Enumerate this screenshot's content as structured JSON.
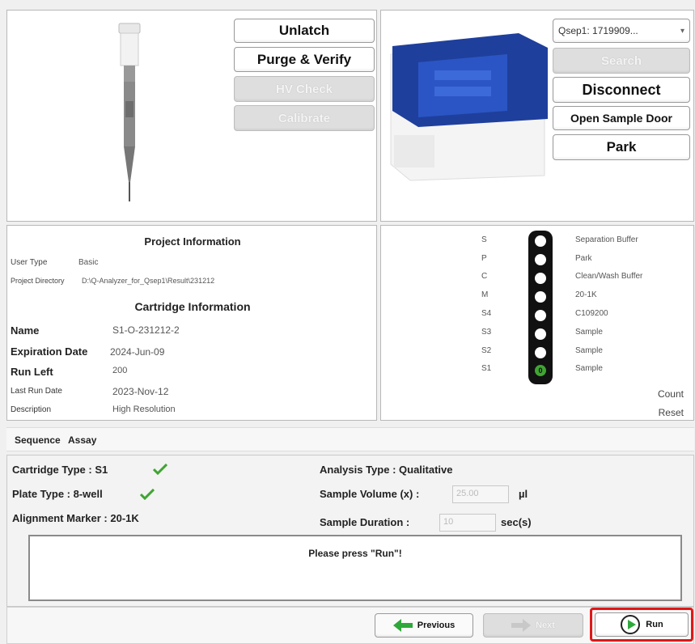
{
  "left_buttons": {
    "unlatch": "Unlatch",
    "purge_verify": "Purge & Verify",
    "hv_check": "HV Check",
    "calibrate": "Calibrate"
  },
  "right_buttons": {
    "device_select": "Qsep1: 1719909...",
    "search": "Search",
    "disconnect": "Disconnect",
    "open_sample_door": "Open Sample Door",
    "park": "Park"
  },
  "project": {
    "title": "Project Information",
    "user_type_label": "User Type",
    "user_type_value": "Basic",
    "dir_label": "Project Directory",
    "dir_value": "D:\\Q-Analyzer_for_Qsep1\\Result\\231212"
  },
  "cartridge": {
    "title": "Cartridge Information",
    "name_label": "Name",
    "name_value": "S1-O-231212-2",
    "exp_label": "Expiration Date",
    "exp_value": "2024-Jun-09",
    "run_left_label": "Run Left",
    "run_left_value": "200",
    "last_run_label": "Last Run Date",
    "last_run_value": "2023-Nov-12",
    "desc_label": "Description",
    "desc_value": "High Resolution"
  },
  "tray": {
    "slots": [
      {
        "code": "S",
        "name": "Separation Buffer"
      },
      {
        "code": "P",
        "name": "Park"
      },
      {
        "code": "C",
        "name": "Clean/Wash Buffer"
      },
      {
        "code": "M",
        "name": "20-1K"
      },
      {
        "code": "S4",
        "name": "C109200"
      },
      {
        "code": "S3",
        "name": "Sample"
      },
      {
        "code": "S2",
        "name": "Sample"
      },
      {
        "code": "S1",
        "name": "Sample"
      }
    ],
    "active_marker": "0",
    "count_label": "Count",
    "reset_label": "Reset"
  },
  "sequence": {
    "label": "Sequence",
    "value": "Assay"
  },
  "settings": {
    "cartridge_type": "Cartridge Type : S1",
    "plate_type": "Plate Type : 8-well",
    "alignment_marker": "Alignment Marker : 20-1K",
    "analysis_type": "Analysis Type : Qualitative",
    "sample_volume_label": "Sample Volume (x) :",
    "sample_volume_value": "25.00",
    "sample_volume_unit": "µl",
    "sample_duration_label": "Sample Duration :",
    "sample_duration_value": "10",
    "sample_duration_unit": "sec(s)"
  },
  "message": "Please press \"Run\"!",
  "nav": {
    "previous": "Previous",
    "next": "Next",
    "run": "Run"
  },
  "colors": {
    "check_green": "#3fa531",
    "run_highlight": "#e01818",
    "nav_arrow_green": "#2ea83a",
    "tray_dark": "#111111",
    "device_blue": "#1f3f9c"
  }
}
